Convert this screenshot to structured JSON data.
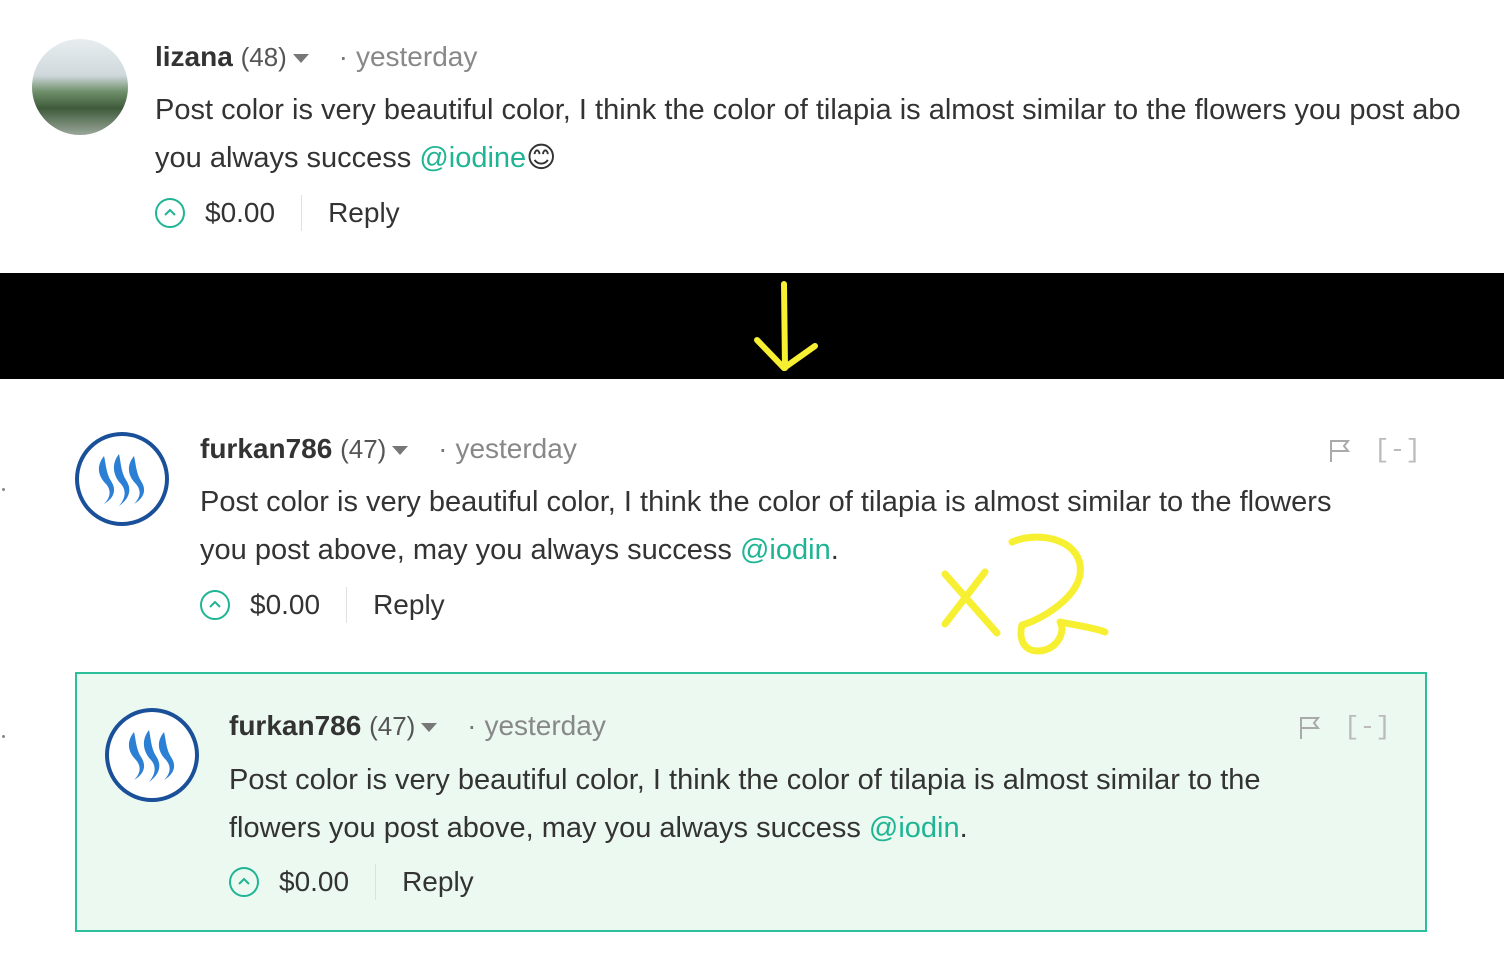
{
  "colors": {
    "accent": "#1fb594",
    "annotation": "#f7f032",
    "highlight_bg": "#ebf9f0",
    "highlight_border": "#2bbf9b"
  },
  "comments": [
    {
      "author": "lizana",
      "reputation": "(48)",
      "time_sep": "·",
      "time": "yesterday",
      "line1": "Post color is very beautiful color, I think the color of tilapia is almost similar to the flowers you post abo",
      "line2_prefix": "you always success ",
      "mention": "@iodine",
      "line2_suffix": "",
      "emoji": "😊",
      "amount": "$0.00",
      "reply": "Reply"
    },
    {
      "author": "furkan786",
      "reputation": "(47)",
      "time_sep": "·",
      "time": "yesterday",
      "line1": "Post color is very beautiful color, I think the color of tilapia is almost similar to the flowers",
      "line2_prefix": "you post above, may you always success ",
      "mention": "@iodin",
      "line2_suffix": ".",
      "amount": "$0.00",
      "reply": "Reply",
      "collapse": "[-]"
    },
    {
      "author": "furkan786",
      "reputation": "(47)",
      "time_sep": "·",
      "time": "yesterday",
      "line1": "Post color is very beautiful color, I think the color of tilapia is almost similar to the",
      "line2_prefix": "flowers you post above, may you always success ",
      "mention": "@iodin",
      "line2_suffix": ".",
      "amount": "$0.00",
      "reply": "Reply",
      "collapse": "[-]"
    }
  ],
  "annotation": {
    "arrow": "down-arrow-icon",
    "mark": "x2"
  }
}
